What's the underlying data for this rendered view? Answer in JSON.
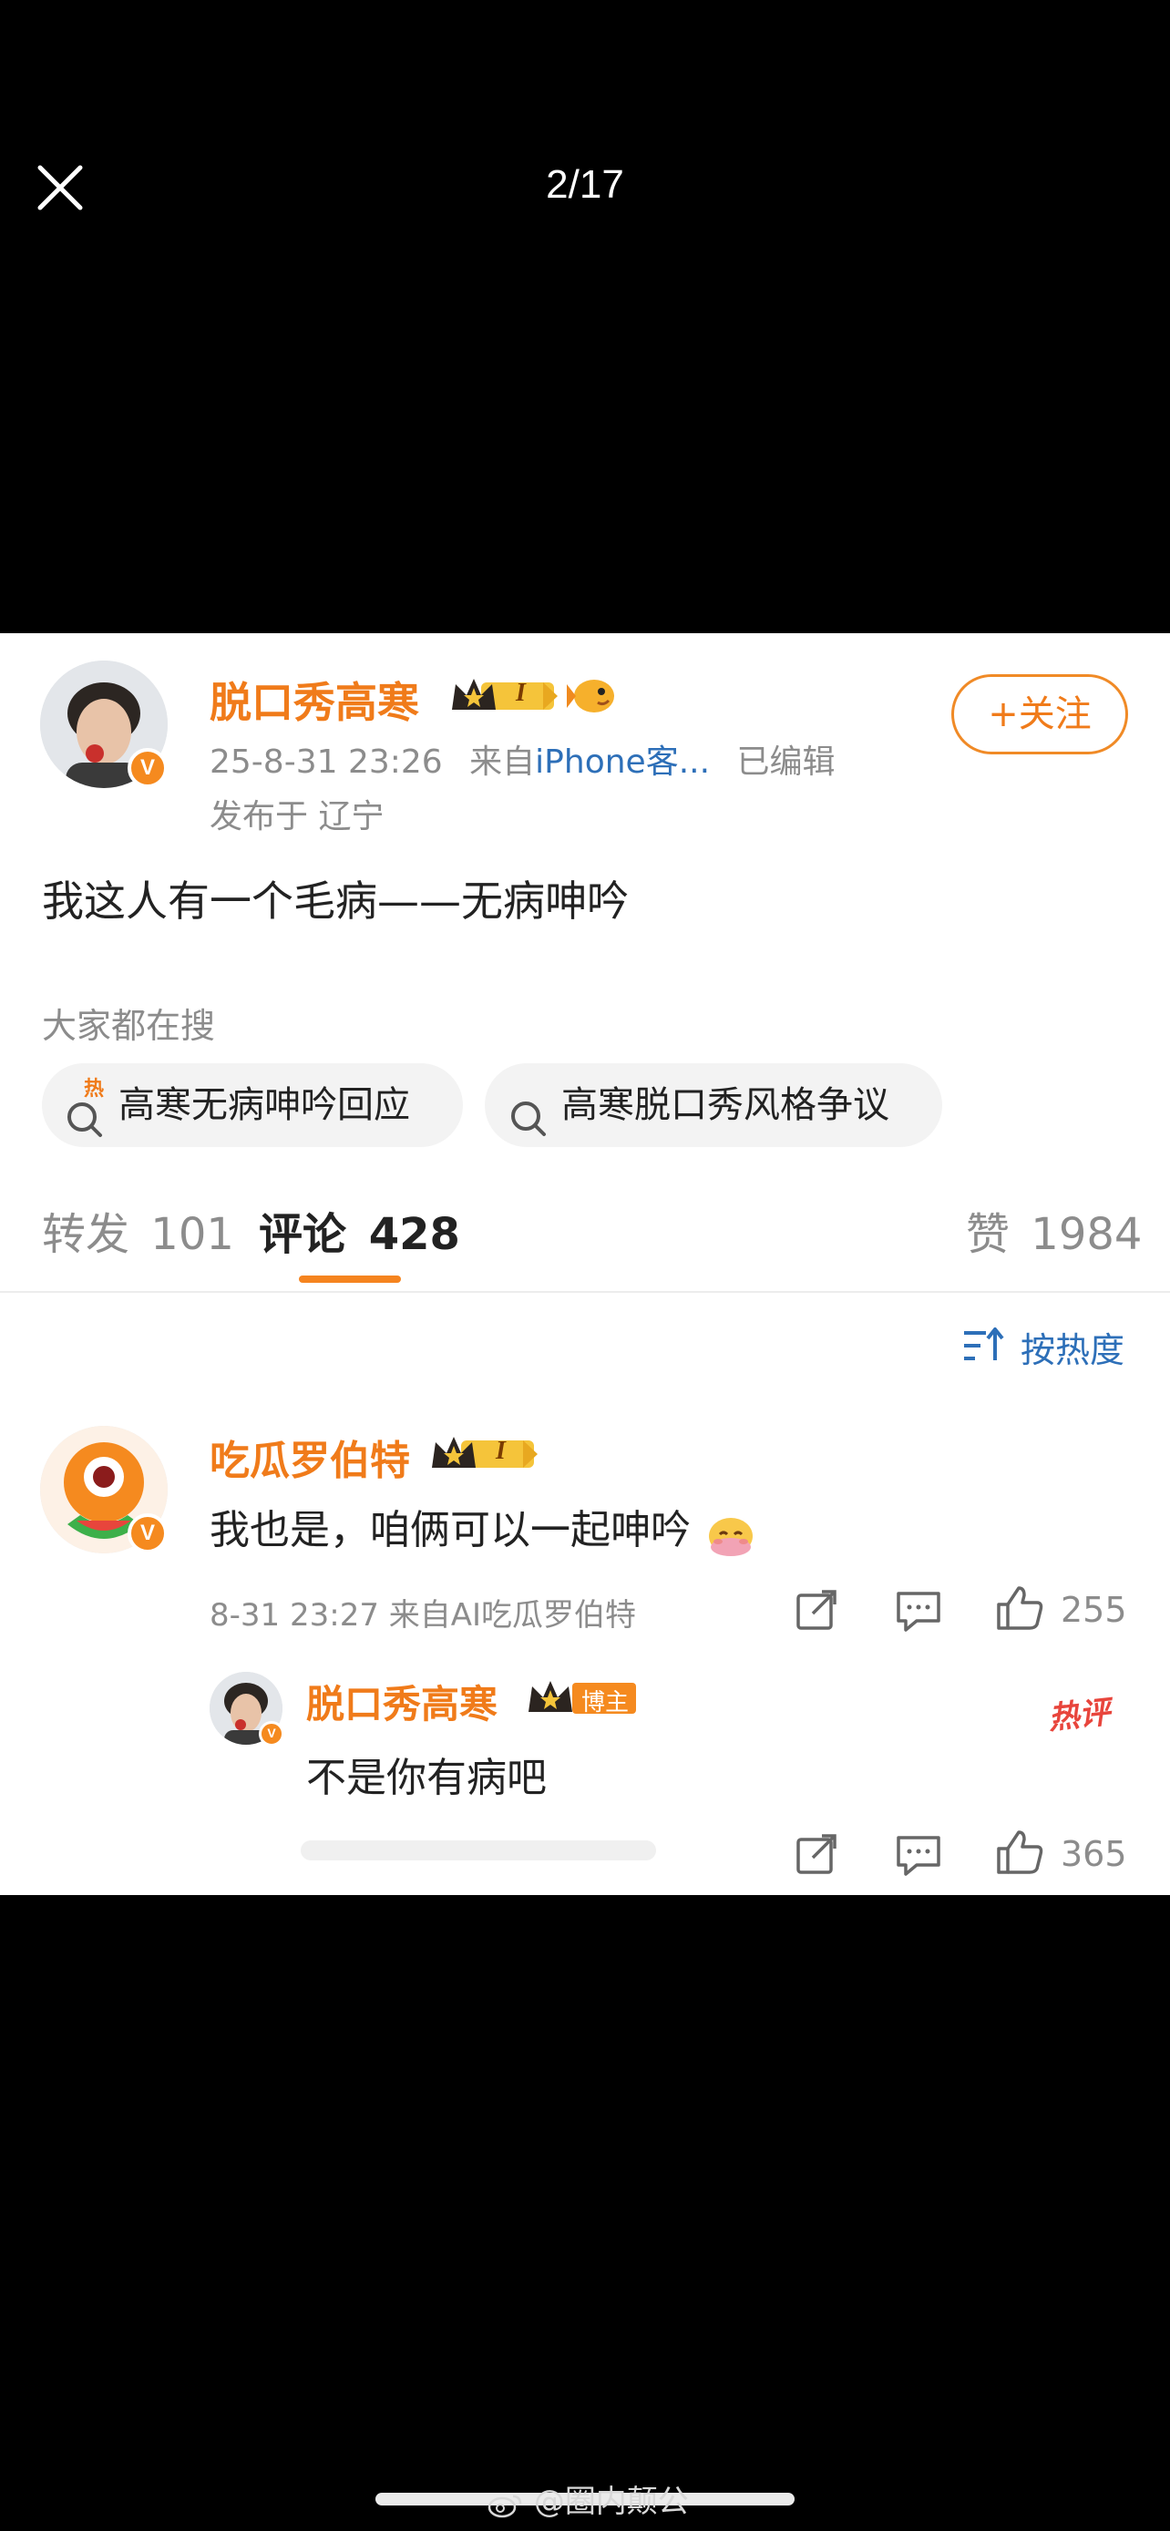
{
  "viewer": {
    "counter": "2/17"
  },
  "post": {
    "author": "脱口秀高寒",
    "timestamp": "25-8-31 23:26",
    "source_prefix": "来自",
    "source": "iPhone客...",
    "edited": "已编辑",
    "location": "发布于 辽宁",
    "follow_label": "+关注",
    "level_badge": "I",
    "verified_badge": "V",
    "text": "我这人有一个毛病——无病呻吟"
  },
  "search": {
    "label": "大家都在搜",
    "chips": [
      {
        "text": "高寒无病呻吟回应",
        "hot_mark": "热"
      },
      {
        "text": "高寒脱口秀风格争议"
      }
    ]
  },
  "tabs": {
    "repost": {
      "label": "转发",
      "count": "101"
    },
    "comment": {
      "label": "评论",
      "count": "428"
    },
    "like": {
      "label": "赞",
      "count": "1984"
    }
  },
  "sort_label": "按热度",
  "comments": [
    {
      "author": "吃瓜罗伯特",
      "level_badge": "I",
      "text": "我也是，咱俩可以一起呻吟",
      "meta": "8-31 23:27 来自AI吃瓜罗伯特",
      "likes": "255"
    }
  ],
  "reply": {
    "author": "脱口秀高寒",
    "badge": "博主",
    "hot_tag": "热评",
    "text": "不是你有病吧",
    "likes": "365"
  },
  "watermark": "@圈内颠公",
  "colors": {
    "brand_orange": "#f07b1a",
    "link_blue": "#2d6fb8",
    "hot_red": "#e8453c"
  }
}
